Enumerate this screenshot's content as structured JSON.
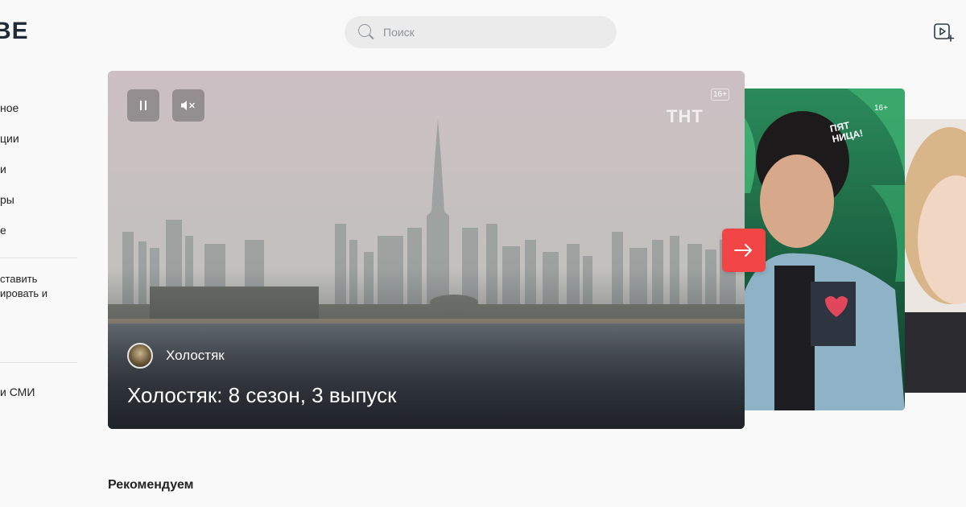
{
  "logo": {
    "text": "BE"
  },
  "search": {
    "placeholder": "Поиск"
  },
  "sidebar": {
    "items": [
      {
        "label": "ное"
      },
      {
        "label": "ции"
      },
      {
        "label": "и"
      },
      {
        "label": "ры"
      },
      {
        "label": "е"
      }
    ],
    "promo_text": "ставить\nировать и",
    "bottom_item": "и СМИ"
  },
  "hero": {
    "age_rating": "16+",
    "channel_logo": "ТНТ",
    "show_name": "Холостяк",
    "episode_title": "Холостяк: 8 сезон, 3 выпуск"
  },
  "next_card": {
    "age_rating": "16+",
    "sign_text": "ПЯТ НИЦА!"
  },
  "sections": {
    "recommended_title": "Рекомендуем"
  },
  "colors": {
    "accent": "#f24646",
    "background": "#f9f9f9",
    "text": "#232324",
    "search_bg": "#ebebeb"
  },
  "icons": {
    "search": "search-icon",
    "upload": "video-upload-icon",
    "pause": "pause-icon",
    "mute": "mute-icon",
    "next": "arrow-right-icon"
  }
}
